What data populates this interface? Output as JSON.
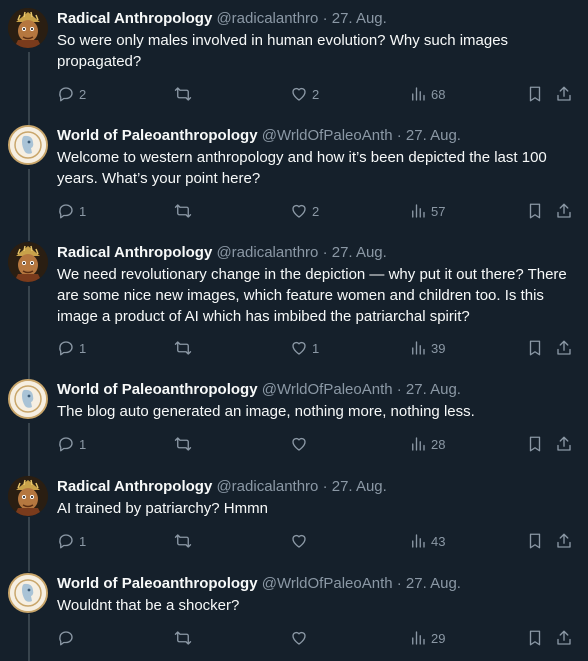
{
  "tweets": [
    {
      "author": "Radical Anthropology",
      "handle": "@radicalanthro",
      "date": "27. Aug.",
      "text": "So were only males involved in human evolution? Why such images propagated?",
      "replies": "2",
      "retweets": "",
      "likes": "2",
      "views": "68",
      "avatar": "radical"
    },
    {
      "author": "World of Paleoanthropology",
      "handle": "@WrldOfPaleoAnth",
      "date": "27. Aug.",
      "text": "Welcome to western anthropology and how it’s been depicted the last 100 years. What’s your point here?",
      "replies": "1",
      "retweets": "",
      "likes": "2",
      "views": "57",
      "avatar": "paleo"
    },
    {
      "author": "Radical Anthropology",
      "handle": "@radicalanthro",
      "date": "27. Aug.",
      "text": "We need revolutionary change in the depiction — why put it out there? There are some nice new images, which feature women and children too. Is this image a product of AI which has imbibed the patriarchal spirit?",
      "replies": "1",
      "retweets": "",
      "likes": "1",
      "views": "39",
      "avatar": "radical"
    },
    {
      "author": "World of Paleoanthropology",
      "handle": "@WrldOfPaleoAnth",
      "date": "27. Aug.",
      "text": "The blog auto generated an image, nothing more, nothing less.",
      "replies": "1",
      "retweets": "",
      "likes": "",
      "views": "28",
      "avatar": "paleo"
    },
    {
      "author": "Radical Anthropology",
      "handle": "@radicalanthro",
      "date": "27. Aug.",
      "text": "AI trained by patriarchy? Hmmn",
      "replies": "1",
      "retweets": "",
      "likes": "",
      "views": "43",
      "avatar": "radical"
    },
    {
      "author": "World of Paleoanthropology",
      "handle": "@WrldOfPaleoAnth",
      "date": "27. Aug.",
      "text": "Wouldnt that be a shocker?",
      "replies": "",
      "retweets": "",
      "likes": "",
      "views": "29",
      "avatar": "paleo"
    }
  ],
  "separator": "·",
  "icons": {
    "reply": "reply-icon",
    "retweet": "retweet-icon",
    "like": "heart-icon",
    "views": "views-icon",
    "bookmark": "bookmark-icon",
    "share": "share-icon"
  },
  "colors": {
    "background": "#15202b",
    "text": "#f7f9f9",
    "secondary": "#8b98a5",
    "thread_line": "#38444d"
  }
}
